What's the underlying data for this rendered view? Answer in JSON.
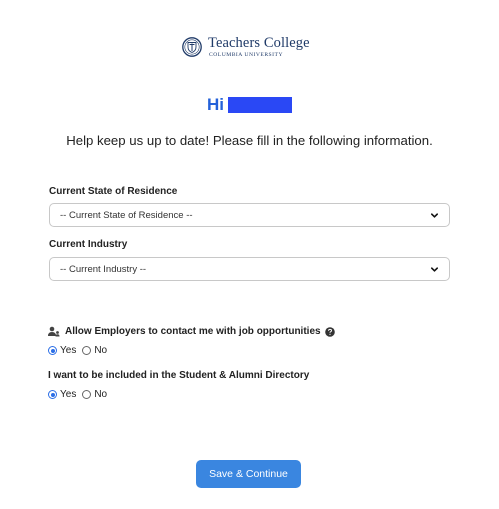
{
  "logo": {
    "name": "Teachers College",
    "subtitle": "COLUMBIA UNIVERSITY"
  },
  "greeting": {
    "hi": "Hi"
  },
  "intro": "Help keep us up to date! Please fill in the following information.",
  "form": {
    "state": {
      "label": "Current State of Residence",
      "value": "-- Current State of Residence --"
    },
    "industry": {
      "label": "Current Industry",
      "value": "-- Current Industry --"
    },
    "employers_question": {
      "label": "Allow Employers to contact me with job opportunities",
      "options": [
        "Yes",
        "No"
      ],
      "selected": "Yes"
    },
    "directory_question": {
      "label": "I want to be included in the Student & Alumni Directory",
      "options": [
        "Yes",
        "No"
      ],
      "selected": "Yes"
    },
    "submit_label": "Save & Continue"
  },
  "colors": {
    "brand_navy": "#1f3a68",
    "greeting_blue": "#2461d9",
    "button_blue": "#3a86e0",
    "radio_blue": "#2b6ee6"
  },
  "icons": {
    "logo": "shield-seal-icon",
    "chevron": "chevron-down-icon",
    "people": "people-icon",
    "help": "question-circle-icon"
  }
}
